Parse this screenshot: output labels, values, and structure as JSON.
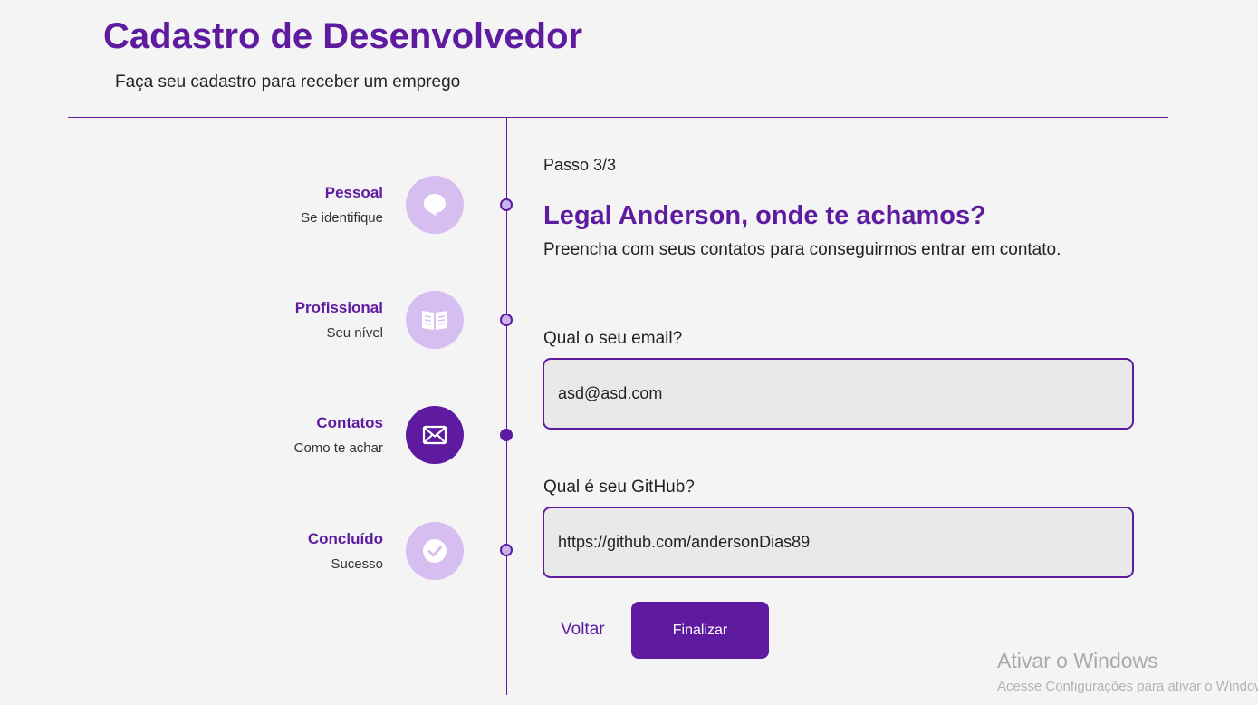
{
  "header": {
    "title": "Cadastro de Desenvolvedor",
    "subtitle": "Faça seu cadastro para receber um emprego"
  },
  "steps": [
    {
      "title": "Pessoal",
      "description": "Se identifique",
      "icon": "chat-bubble-icon",
      "active": false
    },
    {
      "title": "Profissional",
      "description": "Seu nível",
      "icon": "book-icon",
      "active": false
    },
    {
      "title": "Contatos",
      "description": "Como te achar",
      "icon": "mail-icon",
      "active": true
    },
    {
      "title": "Concluído",
      "description": "Sucesso",
      "icon": "check-icon",
      "active": false
    }
  ],
  "form": {
    "step_counter": "Passo 3/3",
    "title": "Legal Anderson, onde te achamos?",
    "description": "Preencha com seus contatos para conseguirmos entrar em contato.",
    "email_label": "Qual o seu email?",
    "email_value": "asd@asd.com",
    "github_label": "Qual é seu GitHub?",
    "github_value": "https://github.com/andersonDias89",
    "back_label": "Voltar",
    "finish_label": "Finalizar"
  },
  "watermark": {
    "title": "Ativar o Windows",
    "subtitle": "Acesse Configurações para ativar o Windows."
  },
  "colors": {
    "primary": "#5e1ba0",
    "step_inactive": "#d6bef0",
    "background": "#f4f4f4",
    "input_background": "#e9e9e9"
  }
}
